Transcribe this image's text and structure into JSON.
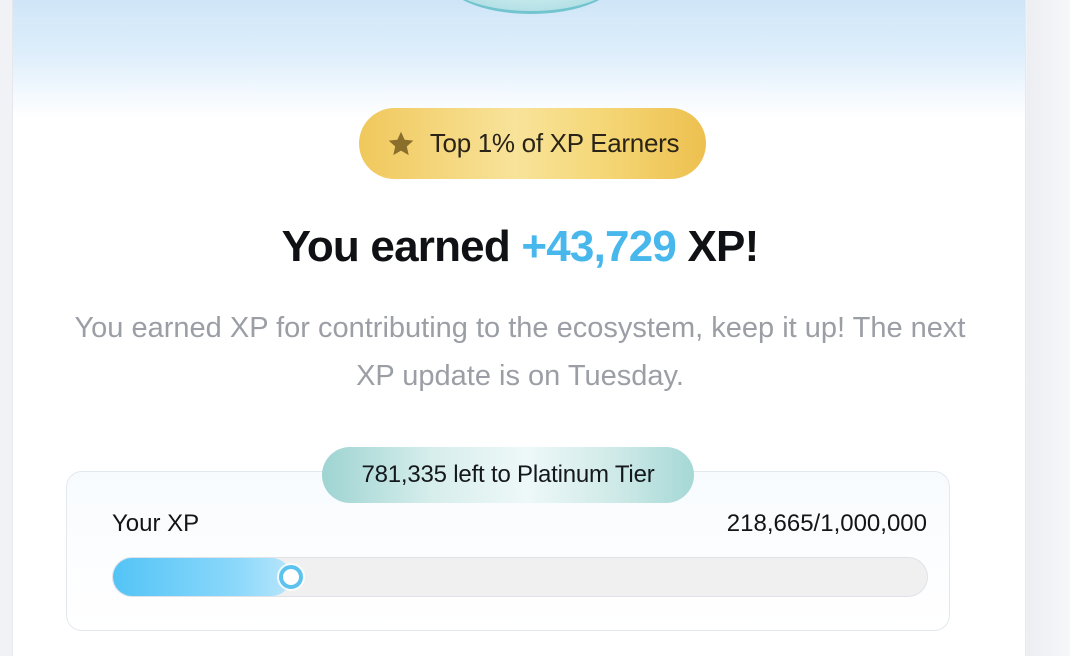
{
  "badge": {
    "icon": "star-icon",
    "label": "Top 1% of XP Earners"
  },
  "headline": {
    "prefix": "You earned",
    "amount": "+43,729",
    "suffix": "XP!"
  },
  "subtext": "You earned XP for contributing to the ecosystem, keep it up! The next XP update is on Tuesday.",
  "progress": {
    "tier_note": "781,335 left to Platinum Tier",
    "label": "Your XP",
    "value_text": "218,665/1,000,000",
    "current": 218665,
    "max": 1000000
  },
  "colors": {
    "accent": "#48b8ec",
    "badge_gold": "#f0c85c",
    "star": "#8a6f2c",
    "tier_teal": "#9ed4d2"
  }
}
